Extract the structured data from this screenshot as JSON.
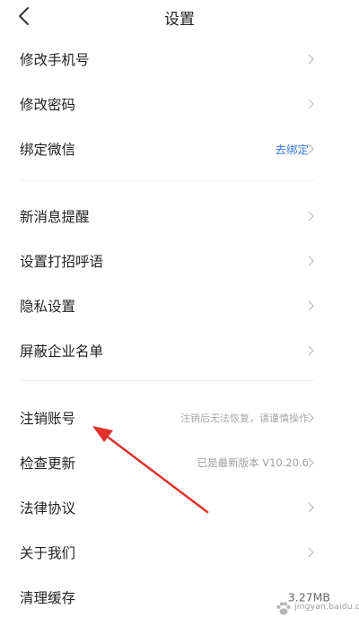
{
  "header": {
    "title": "设置"
  },
  "rows": [
    {
      "label": "修改手机号",
      "value": ""
    },
    {
      "label": "修改密码",
      "value": ""
    },
    {
      "label": "绑定微信",
      "value": "去绑定"
    },
    {
      "label": "新消息提醒",
      "value": ""
    },
    {
      "label": "设置打招呼语",
      "value": ""
    },
    {
      "label": "隐私设置",
      "value": ""
    },
    {
      "label": "屏蔽企业名单",
      "value": ""
    },
    {
      "label": "注销账号",
      "value": "注销后无法恢复，请谨慎操作"
    },
    {
      "label": "检查更新",
      "value": "已是最新版本 V10.20.6"
    },
    {
      "label": "法律协议",
      "value": ""
    },
    {
      "label": "关于我们",
      "value": ""
    },
    {
      "label": "清理缓存",
      "value": "3.27MB"
    }
  ],
  "watermark": {
    "text": "jingyan.baidu.com"
  },
  "colors": {
    "link": "#3b7be0",
    "annotation_arrow": "#e0302a",
    "divider": "#eeeeee"
  }
}
